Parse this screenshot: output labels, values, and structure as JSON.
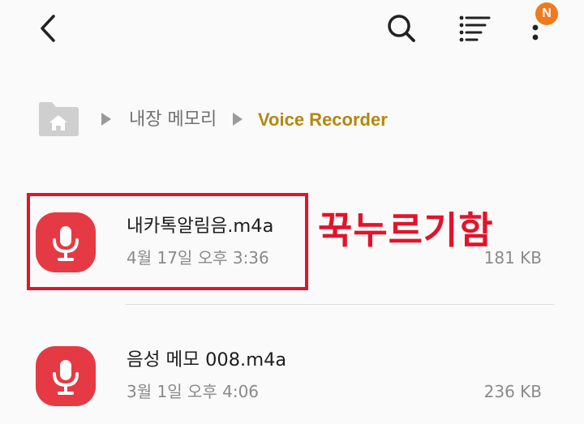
{
  "topbar": {
    "back_icon": "chevron-left-icon",
    "search_icon": "search-icon",
    "sort_icon": "list-sort-icon",
    "more_icon": "more-vertical-icon",
    "notification_badge": "N",
    "badge_color": "#f07a1c"
  },
  "breadcrumb": {
    "home_icon": "folder-home-icon",
    "items": [
      "내장 메모리",
      "Voice Recorder"
    ],
    "active_color": "#b5860f"
  },
  "files": [
    {
      "name": "내카톡알림음.m4a",
      "date": "4월 17일 오후 3:36",
      "size": "181 KB",
      "icon": "microphone-icon"
    },
    {
      "name": "음성 메모 008.m4a",
      "date": "3월 1일 오후 4:06",
      "size": "236 KB",
      "icon": "microphone-icon"
    }
  ],
  "annotation": {
    "text": "꾹누르기함",
    "color": "#e3132a"
  },
  "colors": {
    "icon_bg": "#e53a44"
  }
}
